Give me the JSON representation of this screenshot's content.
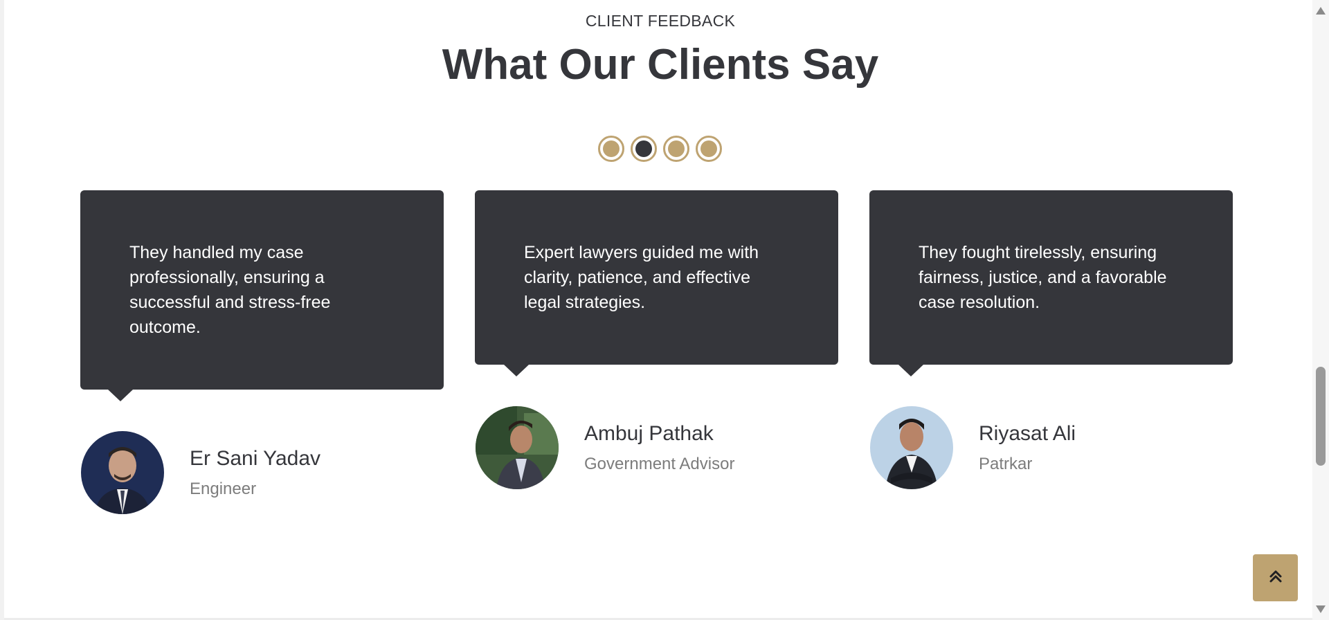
{
  "section": {
    "eyebrow": "CLIENT FEEDBACK",
    "title": "What Our Clients Say"
  },
  "carousel": {
    "dots": 4,
    "active_index": 1
  },
  "testimonials": [
    {
      "quote": "They handled my case professionally, ensuring a successful and stress-free outcome.",
      "name": "Er Sani Yadav",
      "role": "Engineer"
    },
    {
      "quote": "Expert lawyers guided me with clarity, patience, and effective legal strategies.",
      "name": "Ambuj Pathak",
      "role": "Government Advisor"
    },
    {
      "quote": "They fought tirelessly, ensuring fairness, justice, and a favorable case resolution.",
      "name": "Riyasat Ali",
      "role": "Patrkar"
    }
  ],
  "back_to_top": {
    "icon": "double-chevron-up-icon"
  },
  "colors": {
    "dark": "#35363b",
    "gold": "#bea371",
    "muted": "#7c7c7c"
  }
}
